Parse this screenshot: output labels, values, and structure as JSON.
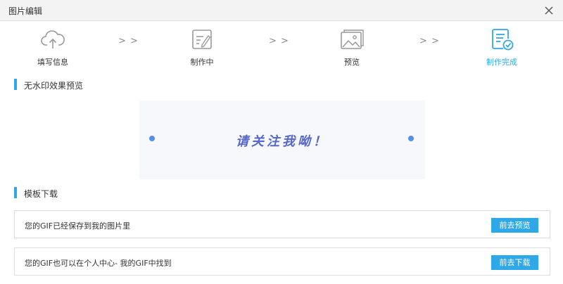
{
  "window": {
    "title": "图片编辑"
  },
  "steps": [
    {
      "label": "填写信息",
      "icon": "cloud-upload-icon",
      "active": false
    },
    {
      "label": "制作中",
      "icon": "edit-document-icon",
      "active": false
    },
    {
      "label": "预览",
      "icon": "image-gallery-icon",
      "active": false
    },
    {
      "label": "制作完成",
      "icon": "document-check-icon",
      "active": true
    }
  ],
  "step_separator": "> >",
  "colors": {
    "accent": "#2fa8e8",
    "preview_text": "#5566cc",
    "preview_dot": "#5a8de6"
  },
  "preview_section": {
    "heading": "无水印效果预览",
    "message": "请关注我呦！"
  },
  "download_section": {
    "heading": "模板下载",
    "rows": [
      {
        "text": "您的GIF已经保存到我的图片里",
        "button": "前去预览"
      },
      {
        "text": "您的GIF也可以在个人中心- 我的GIF中找到",
        "button": "前去下载"
      }
    ]
  }
}
